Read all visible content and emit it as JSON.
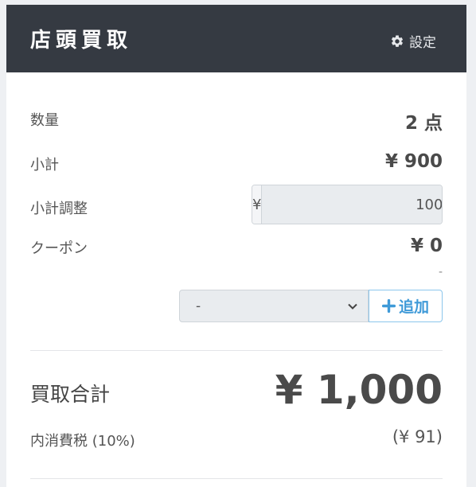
{
  "header": {
    "title": "店頭買取",
    "settings_label": "設定",
    "settings_icon": "gear-icon"
  },
  "rows": {
    "quantity": {
      "label": "数量",
      "value": "2 点"
    },
    "subtotal": {
      "label": "小計",
      "value": "¥ 900"
    },
    "adjustment": {
      "label": "小計調整",
      "currency": "¥",
      "value": "100"
    },
    "coupon": {
      "label": "クーポン",
      "value": "¥ 0",
      "note": "-"
    }
  },
  "coupon_select": {
    "selected": "-"
  },
  "add_button": {
    "label": "追加",
    "icon": "plus-icon"
  },
  "total": {
    "label": "買取合計",
    "value": "¥ 1,000",
    "tax_label": "内消費税 (10%)",
    "tax_value": "(¥ 91)"
  },
  "colors": {
    "header_bg": "#353a42",
    "accent": "#3f9ad8",
    "page_bg": "#eef0f3"
  }
}
